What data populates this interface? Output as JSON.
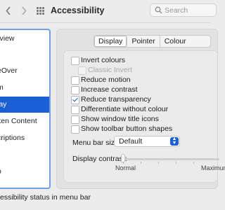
{
  "window": {
    "title": "Accessibility"
  },
  "toolbar": {
    "search_placeholder": "Search",
    "back_icon": "chevron-left-icon",
    "forward_icon": "chevron-right-icon",
    "grid_icon": "grid-icon"
  },
  "sidebar": {
    "items": [
      {
        "label": "rview"
      },
      {
        "label": ""
      },
      {
        "label": "eOver"
      },
      {
        "label": "m"
      },
      {
        "label": "lay",
        "active": true
      },
      {
        "label": "ken Content"
      },
      {
        "label": "criptions"
      },
      {
        "label": ""
      },
      {
        "label": "o"
      }
    ]
  },
  "tabs": [
    {
      "label": "Display",
      "selected": true
    },
    {
      "label": "Pointer",
      "selected": false
    },
    {
      "label": "Colour Filters",
      "selected": false
    }
  ],
  "options": [
    {
      "label": "Invert colours",
      "checked": false,
      "disabled": false
    },
    {
      "label": "Classic Invert",
      "checked": false,
      "disabled": true
    },
    {
      "label": "Reduce motion",
      "checked": false,
      "disabled": false
    },
    {
      "label": "Increase contrast",
      "checked": false,
      "disabled": false
    },
    {
      "label": "Reduce transparency",
      "checked": true,
      "disabled": false
    },
    {
      "label": "Differentiate without colour",
      "checked": false,
      "disabled": false
    },
    {
      "label": "Show window title icons",
      "checked": false,
      "disabled": false
    },
    {
      "label": "Show toolbar button shapes",
      "checked": false,
      "disabled": false
    }
  ],
  "menu_bar_size": {
    "label": "Menu bar size:",
    "value": "Default"
  },
  "display_contrast": {
    "label": "Display contrast:",
    "min_label": "Normal",
    "max_label": "Maximum",
    "value": 0
  },
  "footer": {
    "status_text": "essibility status in menu bar"
  },
  "colors": {
    "accent": "#1a5fd6",
    "focus_ring": "#6ea1e8"
  }
}
